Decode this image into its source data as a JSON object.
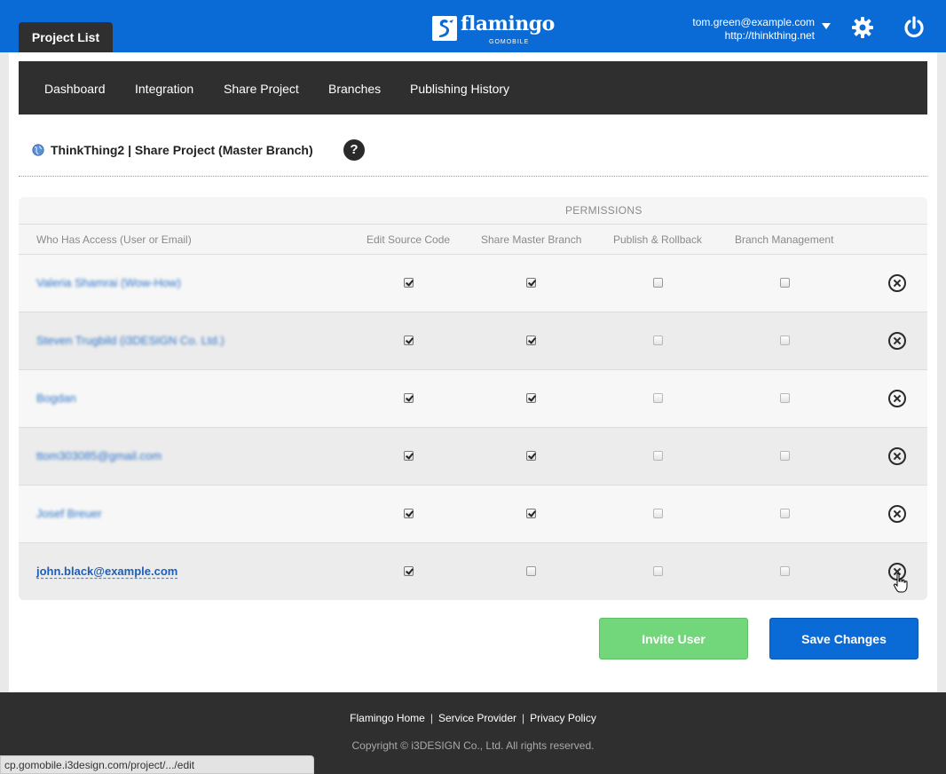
{
  "header": {
    "tab_label": "Project List",
    "logo_text": "flamingo",
    "logo_sub": "GOMOBILE",
    "user_email": "tom.green@example.com",
    "user_site": "http://thinkthing.net",
    "brand_color": "#0a6ad6"
  },
  "subnav": {
    "items": [
      "Dashboard",
      "Integration",
      "Share Project",
      "Branches",
      "Publishing History"
    ]
  },
  "page": {
    "title": "ThinkThing2 | Share Project (Master Branch)",
    "help_label": "?"
  },
  "table": {
    "group_header": "PERMISSIONS",
    "columns": [
      "Who Has Access (User or Email)",
      "Edit Source Code",
      "Share Master Branch",
      "Publish & Rollback",
      "Branch Management"
    ],
    "rows": [
      {
        "user": "Valeria Shamrai (Wow-How)",
        "perms": [
          true,
          true,
          false,
          false
        ]
      },
      {
        "user": "Steven Trugbild (i3DESIGN Co. Ltd.)",
        "perms": [
          true,
          true,
          false,
          false
        ]
      },
      {
        "user": "Bogdan",
        "perms": [
          true,
          true,
          false,
          false
        ]
      },
      {
        "user": "ttom303085@gmail.com",
        "perms": [
          true,
          true,
          false,
          false
        ]
      },
      {
        "user": "Josef Breuer",
        "perms": [
          true,
          true,
          false,
          false
        ]
      },
      {
        "user": "john.black@example.com",
        "perms": [
          true,
          false,
          false,
          false
        ]
      }
    ]
  },
  "actions": {
    "invite_label": "Invite User",
    "save_label": "Save Changes",
    "invite_color": "#72d67a",
    "save_color": "#0a6ad6"
  },
  "footer": {
    "links": [
      "Flamingo Home",
      "Service Provider",
      "Privacy Policy"
    ],
    "copyright": "Copyright © i3DESIGN Co., Ltd. All rights reserved."
  },
  "statusbar": {
    "url": "cp.gomobile.i3design.com/project/.../edit"
  }
}
